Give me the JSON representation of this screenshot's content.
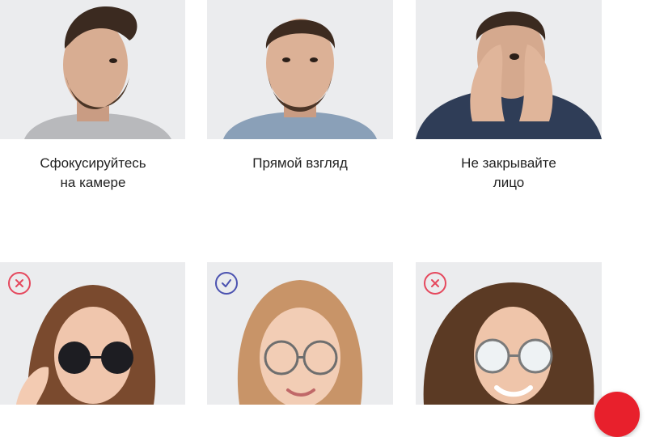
{
  "top_row": [
    {
      "caption_line1": "Сфокусируйтесь",
      "caption_line2": "на камере"
    },
    {
      "caption_line1": "Прямой взгляд",
      "caption_line2": ""
    },
    {
      "caption_line1": "Не закрывайте",
      "caption_line2": "лицо"
    }
  ],
  "bottom_row": [
    {
      "status": "incorrect",
      "icon": "cross-icon"
    },
    {
      "status": "correct",
      "icon": "checkmark-icon"
    },
    {
      "status": "incorrect",
      "icon": "cross-icon"
    }
  ],
  "colors": {
    "incorrect": "#e5485d",
    "correct": "#4b52b0",
    "fab": "#e8202c",
    "card_bg": "#e9eaee"
  }
}
